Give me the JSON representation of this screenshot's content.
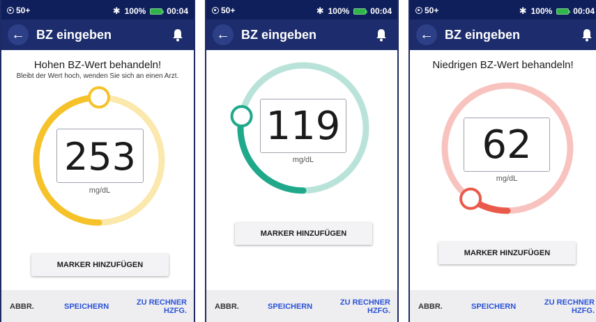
{
  "screens": [
    {
      "status": {
        "pod": "50+",
        "battery": "100%",
        "time": "00:04"
      },
      "title": "BZ eingeben",
      "message_title": "Hohen BZ-Wert behandeln!",
      "message_sub": "Bleibt der Wert hoch, wenden Sie sich an einen Arzt.",
      "value": "253",
      "unit": "mg/dL",
      "gauge_fraction": 0.5,
      "colors": {
        "ring": "#fbe8ad",
        "arc": "#f6c22a",
        "knob_fill": "#ffffff"
      },
      "marker_button": "MARKER HINZUFÜGEN",
      "bottom": {
        "abbr": "ABBR.",
        "save": "SPEICHERN",
        "calc_line1": "ZU RECHNER",
        "calc_line2": "HZFG."
      }
    },
    {
      "status": {
        "pod": "50+",
        "battery": "100%",
        "time": "00:04"
      },
      "title": "BZ eingeben",
      "message_title": "",
      "message_sub": "",
      "value": "119",
      "unit": "mg/dL",
      "gauge_fraction": 0.28,
      "colors": {
        "ring": "#b9e3d9",
        "arc": "#1fa98a",
        "knob_fill": "#ffffff"
      },
      "marker_button": "MARKER HINZUFÜGEN",
      "bottom": {
        "abbr": "ABBR.",
        "save": "SPEICHERN",
        "calc_line1": "ZU RECHNER",
        "calc_line2": "HZFG."
      }
    },
    {
      "status": {
        "pod": "50+",
        "battery": "100%",
        "time": "00:04"
      },
      "title": "BZ eingeben",
      "message_title": "Niedrigen BZ-Wert behandeln!",
      "message_sub": "",
      "value": "62",
      "unit": "mg/dL",
      "gauge_fraction": 0.1,
      "colors": {
        "ring": "#f8c3bf",
        "arc": "#ea5a4a",
        "knob_fill": "#ffffff"
      },
      "marker_button": "MARKER HINZUFÜGEN",
      "bottom": {
        "abbr": "ABBR.",
        "save": "SPEICHERN",
        "calc_line1": "ZU RECHNER",
        "calc_line2": "HZFG."
      }
    }
  ]
}
